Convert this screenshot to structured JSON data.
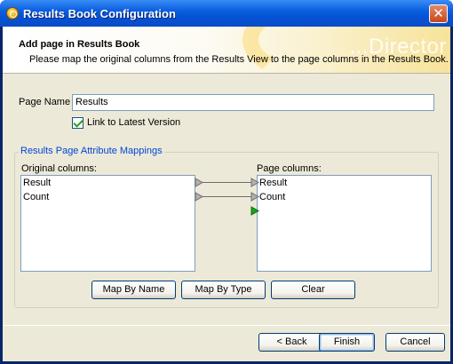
{
  "window": {
    "title": "Results Book Configuration",
    "close_glyph": "✕"
  },
  "header": {
    "title": "Add page in Results Book",
    "description": "Please map the original columns from the Results View to the page columns in the Results Book.",
    "watermark": "...Director"
  },
  "form": {
    "page_name_label": "Page Name",
    "page_name_value": "Results",
    "link_latest_label": "Link to Latest Version",
    "link_latest_checked": true
  },
  "mappings": {
    "group_title": "Results Page Attribute Mappings",
    "original_label": "Original columns:",
    "original_columns": [
      "Result",
      "Count"
    ],
    "page_label": "Page columns:",
    "page_columns": [
      "Result",
      "Count"
    ],
    "arrow_color": "#7d7d7d",
    "add_arrow_color": "#1aa31a"
  },
  "buttons": {
    "map_by_name": "Map By Name",
    "map_by_type": "Map By Type",
    "clear": "Clear",
    "back": "< Back",
    "finish": "Finish",
    "cancel": "Cancel"
  }
}
